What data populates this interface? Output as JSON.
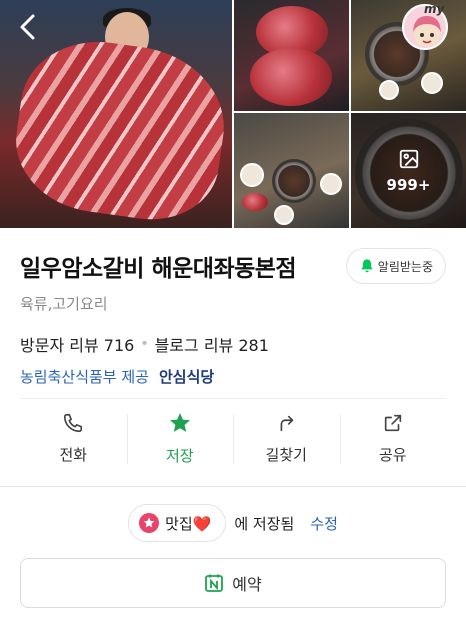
{
  "gallery": {
    "more_count": "999+",
    "my_label": "my"
  },
  "place": {
    "name": "일우암소갈비 해운대좌동본점",
    "notify_label": "알림받는중",
    "category": "육류,고기요리",
    "visitor_reviews_label": "방문자 리뷰 716",
    "blog_reviews_label": "블로그 리뷰 281",
    "provider": "농림축산식품부 제공",
    "safe_label": "안심식당"
  },
  "actions": [
    {
      "label": "전화",
      "icon": "phone-icon"
    },
    {
      "label": "저장",
      "icon": "star-icon"
    },
    {
      "label": "길찾기",
      "icon": "directions-icon"
    },
    {
      "label": "공유",
      "icon": "share-icon"
    }
  ],
  "saved": {
    "chip_label": "맛집❤️",
    "suffix": "에 저장됨",
    "edit_label": "수정"
  },
  "reserve": {
    "label": "예약"
  },
  "colors": {
    "accent_green": "#1fa250",
    "link_blue": "#2a63b8",
    "notify_green": "#03c75a",
    "save_pink": "#e8436a"
  }
}
